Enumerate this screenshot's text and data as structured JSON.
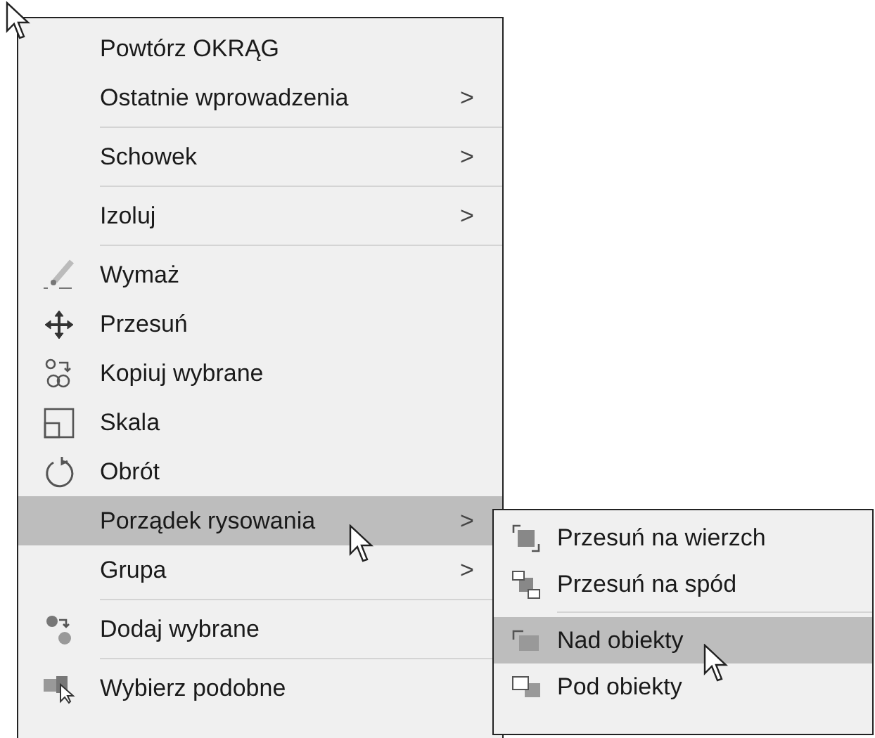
{
  "menu": {
    "items": [
      {
        "kind": "item",
        "label": "Powtórz OKRĄG",
        "selected": false
      },
      {
        "kind": "item",
        "label": "Ostatnie wprowadzenia",
        "arrow": ">",
        "selected": false
      },
      {
        "kind": "separator"
      },
      {
        "kind": "item",
        "label": "Schowek",
        "arrow": ">",
        "selected": false
      },
      {
        "kind": "separator"
      },
      {
        "kind": "item",
        "label": "Izoluj",
        "arrow": ">",
        "selected": false
      },
      {
        "kind": "separator"
      },
      {
        "kind": "item",
        "label": "Wymaż",
        "selected": false
      },
      {
        "kind": "item",
        "label": "Przesuń",
        "selected": false
      },
      {
        "kind": "item",
        "label": "Kopiuj wybrane",
        "selected": false
      },
      {
        "kind": "item",
        "label": "Skala",
        "selected": false
      },
      {
        "kind": "item",
        "label": "Obrót",
        "selected": false
      },
      {
        "kind": "item",
        "label": "Porządek rysowania",
        "arrow": ">",
        "selected": true
      },
      {
        "kind": "item",
        "label": "Grupa",
        "arrow": ">",
        "selected": false
      },
      {
        "kind": "separator"
      },
      {
        "kind": "item",
        "label": "Dodaj wybrane",
        "selected": false
      },
      {
        "kind": "separator"
      },
      {
        "kind": "item",
        "label": "Wybierz podobne",
        "selected": false
      }
    ]
  },
  "submenu": {
    "items": [
      {
        "kind": "item",
        "label": "Przesuń na wierzch",
        "selected": false
      },
      {
        "kind": "item",
        "label": "Przesuń na spód",
        "selected": false
      },
      {
        "kind": "separator"
      },
      {
        "kind": "item",
        "label": "Nad obiekty",
        "selected": true
      },
      {
        "kind": "item",
        "label": "Pod obiekty",
        "selected": false
      }
    ]
  }
}
